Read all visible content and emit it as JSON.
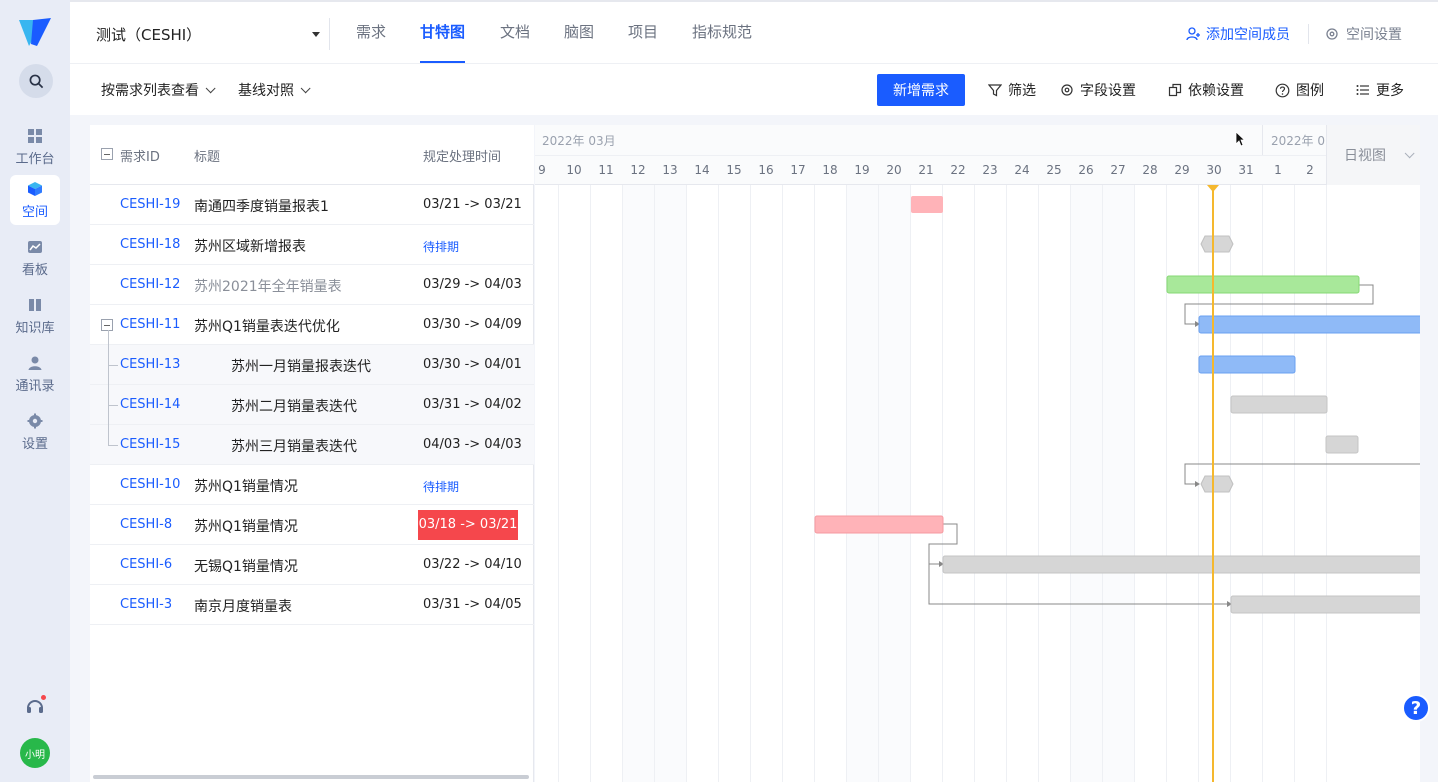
{
  "rail": {
    "items": [
      {
        "label": "工作台"
      },
      {
        "label": "空间"
      },
      {
        "label": "看板"
      },
      {
        "label": "知识库"
      },
      {
        "label": "通讯录"
      },
      {
        "label": "设置"
      }
    ],
    "user": "小明"
  },
  "topnav": {
    "space": "测试（CESHI）",
    "tabs": [
      {
        "label": "需求"
      },
      {
        "label": "甘特图"
      },
      {
        "label": "文档"
      },
      {
        "label": "脑图"
      },
      {
        "label": "项目"
      },
      {
        "label": "指标规范"
      }
    ],
    "add_member": "添加空间成员",
    "space_settings": "空间设置"
  },
  "toolbar": {
    "view_mode": "按需求列表查看",
    "baseline": "基线对照",
    "new_requirement": "新增需求",
    "filter": "筛选",
    "field_settings": "字段设置",
    "dependency_settings": "依赖设置",
    "legend": "图例",
    "more": "更多"
  },
  "table": {
    "headers": {
      "id": "需求ID",
      "title": "标题",
      "time": "规定处理时间"
    },
    "rows": [
      {
        "id": "CESHI-19",
        "title": "南通四季度销量报表1",
        "time": "03/21 -> 03/21"
      },
      {
        "id": "CESHI-18",
        "title": "苏州区域新增报表",
        "time": "待排期"
      },
      {
        "id": "CESHI-12",
        "title": "苏州2021年全年销量表",
        "time": "03/29 -> 04/03"
      },
      {
        "id": "CESHI-11",
        "title": "苏州Q1销量表迭代优化",
        "time": "03/30 -> 04/09"
      },
      {
        "id": "CESHI-13",
        "title": "苏州一月销量报表迭代",
        "time": "03/30 -> 04/01"
      },
      {
        "id": "CESHI-14",
        "title": "苏州二月销量表迭代",
        "time": "03/31 -> 04/02"
      },
      {
        "id": "CESHI-15",
        "title": "苏州三月销量表迭代",
        "time": "04/03 -> 04/03"
      },
      {
        "id": "CESHI-10",
        "title": "苏州Q1销量情况",
        "time": "待排期"
      },
      {
        "id": "CESHI-8",
        "title": "苏州Q1销量情况",
        "time": "03/18 -> 03/21"
      },
      {
        "id": "CESHI-6",
        "title": "无锡Q1销量情况",
        "time": "03/22 -> 04/10"
      },
      {
        "id": "CESHI-3",
        "title": "南京月度销量表",
        "time": "03/31 -> 04/05"
      }
    ]
  },
  "gantt": {
    "months": [
      "2022年 03月",
      "2022年 0"
    ],
    "days": [
      "9",
      "10",
      "11",
      "12",
      "13",
      "14",
      "15",
      "16",
      "17",
      "18",
      "19",
      "20",
      "21",
      "22",
      "23",
      "24",
      "25",
      "26",
      "27",
      "28",
      "29",
      "30",
      "31",
      "1",
      "2"
    ],
    "view_mode": "日视图",
    "colors": {
      "today": "#f5b82e",
      "red": "#ffb3b8",
      "green": "#a8e89a",
      "blue": "#8fbaf7",
      "gray": "#d6d6d6"
    }
  },
  "help": "?"
}
